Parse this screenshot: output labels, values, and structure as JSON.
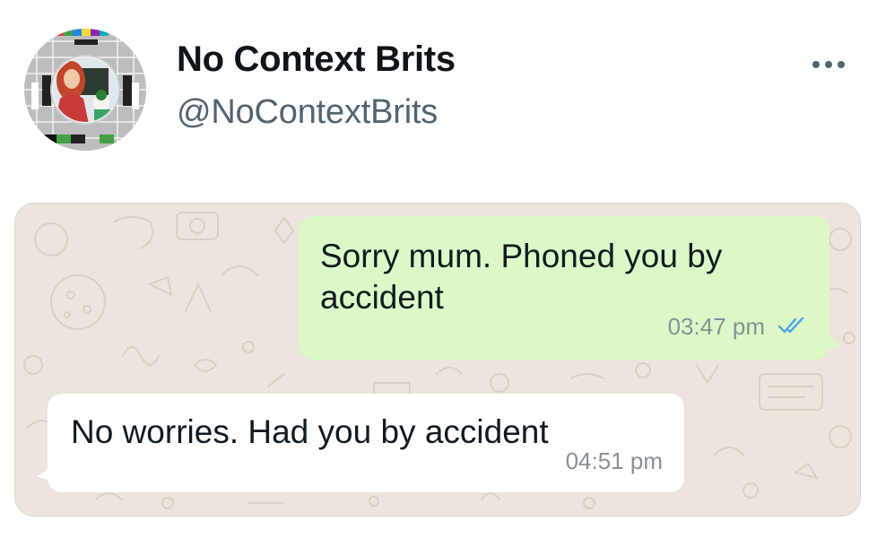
{
  "profile": {
    "display_name": "No Context Brits",
    "handle": "@NoContextBrits",
    "avatar_icon": "test-card-avatar"
  },
  "header": {
    "more_icon": "more-horizontal-icon"
  },
  "chat": {
    "background_color": "#ece5dd",
    "messages": [
      {
        "direction": "outgoing",
        "text": "Sorry mum. Phoned you by accident",
        "time": "03:47 pm",
        "status_icon": "double-check-read-icon",
        "bubble_color": "#dcf8c6"
      },
      {
        "direction": "incoming",
        "text": "No worries. Had you by accident",
        "time": "04:51 pm",
        "bubble_color": "#ffffff"
      }
    ]
  },
  "colors": {
    "read_tick": "#4fa6e0",
    "timestamp": "#8a9196",
    "handle": "#536471"
  }
}
